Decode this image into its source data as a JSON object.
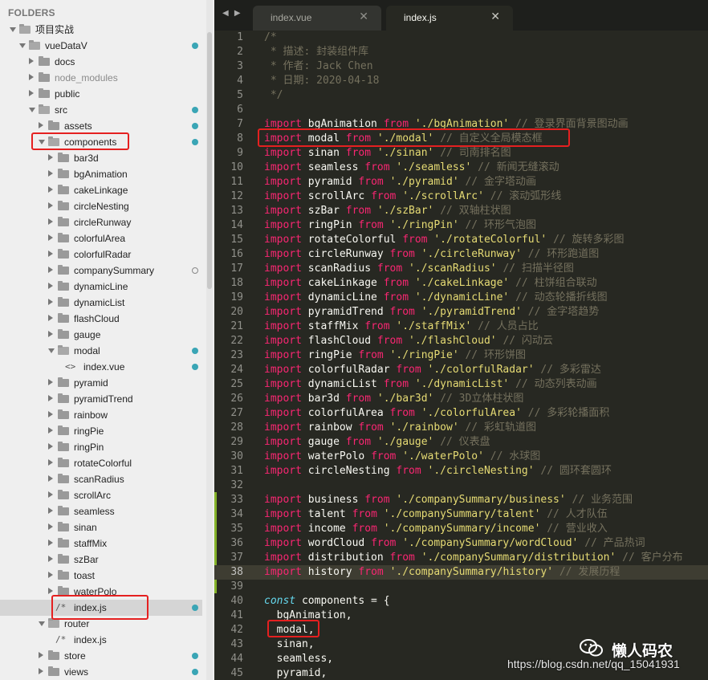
{
  "sidebar": {
    "header": "FOLDERS",
    "tree": [
      {
        "label": "项目实战",
        "depth": 0,
        "type": "folder",
        "expanded": true
      },
      {
        "label": "vueDataV",
        "depth": 1,
        "type": "folder",
        "expanded": true,
        "dot": "filled"
      },
      {
        "label": "docs",
        "depth": 2,
        "type": "folder",
        "expanded": false
      },
      {
        "label": "node_modules",
        "depth": 2,
        "type": "folder",
        "expanded": false,
        "muted": true
      },
      {
        "label": "public",
        "depth": 2,
        "type": "folder",
        "expanded": false
      },
      {
        "label": "src",
        "depth": 2,
        "type": "folder",
        "expanded": true,
        "dot": "filled"
      },
      {
        "label": "assets",
        "depth": 3,
        "type": "folder",
        "expanded": false,
        "dot": "filled"
      },
      {
        "label": "components",
        "depth": 3,
        "type": "folder",
        "expanded": true,
        "dot": "filled"
      },
      {
        "label": "bar3d",
        "depth": 4,
        "type": "folder",
        "expanded": false
      },
      {
        "label": "bgAnimation",
        "depth": 4,
        "type": "folder",
        "expanded": false
      },
      {
        "label": "cakeLinkage",
        "depth": 4,
        "type": "folder",
        "expanded": false
      },
      {
        "label": "circleNesting",
        "depth": 4,
        "type": "folder",
        "expanded": false
      },
      {
        "label": "circleRunway",
        "depth": 4,
        "type": "folder",
        "expanded": false
      },
      {
        "label": "colorfulArea",
        "depth": 4,
        "type": "folder",
        "expanded": false
      },
      {
        "label": "colorfulRadar",
        "depth": 4,
        "type": "folder",
        "expanded": false
      },
      {
        "label": "companySummary",
        "depth": 4,
        "type": "folder",
        "expanded": false,
        "dot": "hollow"
      },
      {
        "label": "dynamicLine",
        "depth": 4,
        "type": "folder",
        "expanded": false
      },
      {
        "label": "dynamicList",
        "depth": 4,
        "type": "folder",
        "expanded": false
      },
      {
        "label": "flashCloud",
        "depth": 4,
        "type": "folder",
        "expanded": false
      },
      {
        "label": "gauge",
        "depth": 4,
        "type": "folder",
        "expanded": false
      },
      {
        "label": "modal",
        "depth": 4,
        "type": "folder",
        "expanded": true,
        "dot": "filled"
      },
      {
        "label": "index.vue",
        "depth": 5,
        "type": "file",
        "icon": "<>",
        "dot": "filled"
      },
      {
        "label": "pyramid",
        "depth": 4,
        "type": "folder",
        "expanded": false
      },
      {
        "label": "pyramidTrend",
        "depth": 4,
        "type": "folder",
        "expanded": false
      },
      {
        "label": "rainbow",
        "depth": 4,
        "type": "folder",
        "expanded": false
      },
      {
        "label": "ringPie",
        "depth": 4,
        "type": "folder",
        "expanded": false
      },
      {
        "label": "ringPin",
        "depth": 4,
        "type": "folder",
        "expanded": false
      },
      {
        "label": "rotateColorful",
        "depth": 4,
        "type": "folder",
        "expanded": false
      },
      {
        "label": "scanRadius",
        "depth": 4,
        "type": "folder",
        "expanded": false
      },
      {
        "label": "scrollArc",
        "depth": 4,
        "type": "folder",
        "expanded": false
      },
      {
        "label": "seamless",
        "depth": 4,
        "type": "folder",
        "expanded": false
      },
      {
        "label": "sinan",
        "depth": 4,
        "type": "folder",
        "expanded": false
      },
      {
        "label": "staffMix",
        "depth": 4,
        "type": "folder",
        "expanded": false
      },
      {
        "label": "szBar",
        "depth": 4,
        "type": "folder",
        "expanded": false
      },
      {
        "label": "toast",
        "depth": 4,
        "type": "folder",
        "expanded": false
      },
      {
        "label": "waterPolo",
        "depth": 4,
        "type": "folder",
        "expanded": false
      },
      {
        "label": "index.js",
        "depth": 4,
        "type": "file",
        "icon": "/*",
        "dot": "filled",
        "selected": true
      },
      {
        "label": "router",
        "depth": 3,
        "type": "folder",
        "expanded": true
      },
      {
        "label": "index.js",
        "depth": 4,
        "type": "file",
        "icon": "/*"
      },
      {
        "label": "store",
        "depth": 3,
        "type": "folder",
        "expanded": false,
        "dot": "filled"
      },
      {
        "label": "views",
        "depth": 3,
        "type": "folder",
        "expanded": false,
        "dot": "filled"
      }
    ]
  },
  "tabs": {
    "nav": "◀ ▶",
    "items": [
      {
        "label": "index.vue",
        "close": "✕",
        "active": false
      },
      {
        "label": "index.js",
        "close": "✕",
        "active": true
      }
    ]
  },
  "editor": {
    "current_line": 38,
    "lines": [
      [
        [
          "c",
          "/*"
        ]
      ],
      [
        [
          "c",
          " * 描述: 封装组件库"
        ]
      ],
      [
        [
          "c",
          " * 作者: Jack Chen"
        ]
      ],
      [
        [
          "c",
          " * 日期: 2020-04-18"
        ]
      ],
      [
        [
          "c",
          " */"
        ]
      ],
      [],
      [
        [
          "k",
          "import"
        ],
        [
          "pl",
          " bgAnimation "
        ],
        [
          "k",
          "from"
        ],
        [
          "pl",
          " "
        ],
        [
          "s",
          "'./bgAnimation'"
        ],
        [
          "pl",
          " "
        ],
        [
          "c",
          "// 登录界面背景图动画"
        ]
      ],
      [
        [
          "k",
          "import"
        ],
        [
          "pl",
          " modal "
        ],
        [
          "k",
          "from"
        ],
        [
          "pl",
          " "
        ],
        [
          "s",
          "'./modal'"
        ],
        [
          "pl",
          " "
        ],
        [
          "c",
          "// 自定义全局模态框"
        ]
      ],
      [
        [
          "k",
          "import"
        ],
        [
          "pl",
          " sinan "
        ],
        [
          "k",
          "from"
        ],
        [
          "pl",
          " "
        ],
        [
          "s",
          "'./sinan'"
        ],
        [
          "pl",
          " "
        ],
        [
          "c",
          "// 司南排名图"
        ]
      ],
      [
        [
          "k",
          "import"
        ],
        [
          "pl",
          " seamless "
        ],
        [
          "k",
          "from"
        ],
        [
          "pl",
          " "
        ],
        [
          "s",
          "'./seamless'"
        ],
        [
          "pl",
          " "
        ],
        [
          "c",
          "// 新闻无缝滚动"
        ]
      ],
      [
        [
          "k",
          "import"
        ],
        [
          "pl",
          " pyramid "
        ],
        [
          "k",
          "from"
        ],
        [
          "pl",
          " "
        ],
        [
          "s",
          "'./pyramid'"
        ],
        [
          "pl",
          " "
        ],
        [
          "c",
          "// 金字塔动画"
        ]
      ],
      [
        [
          "k",
          "import"
        ],
        [
          "pl",
          " scrollArc "
        ],
        [
          "k",
          "from"
        ],
        [
          "pl",
          " "
        ],
        [
          "s",
          "'./scrollArc'"
        ],
        [
          "pl",
          " "
        ],
        [
          "c",
          "// 滚动弧形线"
        ]
      ],
      [
        [
          "k",
          "import"
        ],
        [
          "pl",
          " szBar "
        ],
        [
          "k",
          "from"
        ],
        [
          "pl",
          " "
        ],
        [
          "s",
          "'./szBar'"
        ],
        [
          "pl",
          " "
        ],
        [
          "c",
          "// 双轴柱状图"
        ]
      ],
      [
        [
          "k",
          "import"
        ],
        [
          "pl",
          " ringPin "
        ],
        [
          "k",
          "from"
        ],
        [
          "pl",
          " "
        ],
        [
          "s",
          "'./ringPin'"
        ],
        [
          "pl",
          " "
        ],
        [
          "c",
          "// 环形气泡图"
        ]
      ],
      [
        [
          "k",
          "import"
        ],
        [
          "pl",
          " rotateColorful "
        ],
        [
          "k",
          "from"
        ],
        [
          "pl",
          " "
        ],
        [
          "s",
          "'./rotateColorful'"
        ],
        [
          "pl",
          " "
        ],
        [
          "c",
          "// 旋转多彩图"
        ]
      ],
      [
        [
          "k",
          "import"
        ],
        [
          "pl",
          " circleRunway "
        ],
        [
          "k",
          "from"
        ],
        [
          "pl",
          " "
        ],
        [
          "s",
          "'./circleRunway'"
        ],
        [
          "pl",
          " "
        ],
        [
          "c",
          "// 环形跑道图"
        ]
      ],
      [
        [
          "k",
          "import"
        ],
        [
          "pl",
          " scanRadius "
        ],
        [
          "k",
          "from"
        ],
        [
          "pl",
          " "
        ],
        [
          "s",
          "'./scanRadius'"
        ],
        [
          "pl",
          " "
        ],
        [
          "c",
          "// 扫描半径图"
        ]
      ],
      [
        [
          "k",
          "import"
        ],
        [
          "pl",
          " cakeLinkage "
        ],
        [
          "k",
          "from"
        ],
        [
          "pl",
          " "
        ],
        [
          "s",
          "'./cakeLinkage'"
        ],
        [
          "pl",
          " "
        ],
        [
          "c",
          "// 柱饼组合联动"
        ]
      ],
      [
        [
          "k",
          "import"
        ],
        [
          "pl",
          " dynamicLine "
        ],
        [
          "k",
          "from"
        ],
        [
          "pl",
          " "
        ],
        [
          "s",
          "'./dynamicLine'"
        ],
        [
          "pl",
          " "
        ],
        [
          "c",
          "// 动态轮播折线图"
        ]
      ],
      [
        [
          "k",
          "import"
        ],
        [
          "pl",
          " pyramidTrend "
        ],
        [
          "k",
          "from"
        ],
        [
          "pl",
          " "
        ],
        [
          "s",
          "'./pyramidTrend'"
        ],
        [
          "pl",
          " "
        ],
        [
          "c",
          "// 金字塔趋势"
        ]
      ],
      [
        [
          "k",
          "import"
        ],
        [
          "pl",
          " staffMix "
        ],
        [
          "k",
          "from"
        ],
        [
          "pl",
          " "
        ],
        [
          "s",
          "'./staffMix'"
        ],
        [
          "pl",
          " "
        ],
        [
          "c",
          "// 人员占比"
        ]
      ],
      [
        [
          "k",
          "import"
        ],
        [
          "pl",
          " flashCloud "
        ],
        [
          "k",
          "from"
        ],
        [
          "pl",
          " "
        ],
        [
          "s",
          "'./flashCloud'"
        ],
        [
          "pl",
          " "
        ],
        [
          "c",
          "// 闪动云"
        ]
      ],
      [
        [
          "k",
          "import"
        ],
        [
          "pl",
          " ringPie "
        ],
        [
          "k",
          "from"
        ],
        [
          "pl",
          " "
        ],
        [
          "s",
          "'./ringPie'"
        ],
        [
          "pl",
          " "
        ],
        [
          "c",
          "// 环形饼图"
        ]
      ],
      [
        [
          "k",
          "import"
        ],
        [
          "pl",
          " colorfulRadar "
        ],
        [
          "k",
          "from"
        ],
        [
          "pl",
          " "
        ],
        [
          "s",
          "'./colorfulRadar'"
        ],
        [
          "pl",
          " "
        ],
        [
          "c",
          "// 多彩雷达"
        ]
      ],
      [
        [
          "k",
          "import"
        ],
        [
          "pl",
          " dynamicList "
        ],
        [
          "k",
          "from"
        ],
        [
          "pl",
          " "
        ],
        [
          "s",
          "'./dynamicList'"
        ],
        [
          "pl",
          " "
        ],
        [
          "c",
          "// 动态列表动画"
        ]
      ],
      [
        [
          "k",
          "import"
        ],
        [
          "pl",
          " bar3d "
        ],
        [
          "k",
          "from"
        ],
        [
          "pl",
          " "
        ],
        [
          "s",
          "'./bar3d'"
        ],
        [
          "pl",
          " "
        ],
        [
          "c",
          "// 3D立体柱状图"
        ]
      ],
      [
        [
          "k",
          "import"
        ],
        [
          "pl",
          " colorfulArea "
        ],
        [
          "k",
          "from"
        ],
        [
          "pl",
          " "
        ],
        [
          "s",
          "'./colorfulArea'"
        ],
        [
          "pl",
          " "
        ],
        [
          "c",
          "// 多彩轮播面积"
        ]
      ],
      [
        [
          "k",
          "import"
        ],
        [
          "pl",
          " rainbow "
        ],
        [
          "k",
          "from"
        ],
        [
          "pl",
          " "
        ],
        [
          "s",
          "'./rainbow'"
        ],
        [
          "pl",
          " "
        ],
        [
          "c",
          "// 彩虹轨道图"
        ]
      ],
      [
        [
          "k",
          "import"
        ],
        [
          "pl",
          " gauge "
        ],
        [
          "k",
          "from"
        ],
        [
          "pl",
          " "
        ],
        [
          "s",
          "'./gauge'"
        ],
        [
          "pl",
          " "
        ],
        [
          "c",
          "// 仪表盘"
        ]
      ],
      [
        [
          "k",
          "import"
        ],
        [
          "pl",
          " waterPolo "
        ],
        [
          "k",
          "from"
        ],
        [
          "pl",
          " "
        ],
        [
          "s",
          "'./waterPolo'"
        ],
        [
          "pl",
          " "
        ],
        [
          "c",
          "// 水球图"
        ]
      ],
      [
        [
          "k",
          "import"
        ],
        [
          "pl",
          " circleNesting "
        ],
        [
          "k",
          "from"
        ],
        [
          "pl",
          " "
        ],
        [
          "s",
          "'./circleNesting'"
        ],
        [
          "pl",
          " "
        ],
        [
          "c",
          "// 圆环套圆环"
        ]
      ],
      [],
      [
        [
          "k",
          "import"
        ],
        [
          "pl",
          " business "
        ],
        [
          "k",
          "from"
        ],
        [
          "pl",
          " "
        ],
        [
          "s",
          "'./companySummary/business'"
        ],
        [
          "pl",
          " "
        ],
        [
          "c",
          "// 业务范围"
        ]
      ],
      [
        [
          "k",
          "import"
        ],
        [
          "pl",
          " talent "
        ],
        [
          "k",
          "from"
        ],
        [
          "pl",
          " "
        ],
        [
          "s",
          "'./companySummary/talent'"
        ],
        [
          "pl",
          " "
        ],
        [
          "c",
          "// 人才队伍"
        ]
      ],
      [
        [
          "k",
          "import"
        ],
        [
          "pl",
          " income "
        ],
        [
          "k",
          "from"
        ],
        [
          "pl",
          " "
        ],
        [
          "s",
          "'./companySummary/income'"
        ],
        [
          "pl",
          " "
        ],
        [
          "c",
          "// 营业收入"
        ]
      ],
      [
        [
          "k",
          "import"
        ],
        [
          "pl",
          " wordCloud "
        ],
        [
          "k",
          "from"
        ],
        [
          "pl",
          " "
        ],
        [
          "s",
          "'./companySummary/wordCloud'"
        ],
        [
          "pl",
          " "
        ],
        [
          "c",
          "// 产品热词"
        ]
      ],
      [
        [
          "k",
          "import"
        ],
        [
          "pl",
          " distribution "
        ],
        [
          "k",
          "from"
        ],
        [
          "pl",
          " "
        ],
        [
          "s",
          "'./companySummary/distribution'"
        ],
        [
          "pl",
          " "
        ],
        [
          "c",
          "// 客户分布"
        ]
      ],
      [
        [
          "k",
          "import"
        ],
        [
          "pl",
          " history "
        ],
        [
          "k",
          "from"
        ],
        [
          "pl",
          " "
        ],
        [
          "s",
          "'./companySummary/history'"
        ],
        [
          "pl",
          " "
        ],
        [
          "c",
          "// 发展历程"
        ]
      ],
      [],
      [
        [
          "kw-const",
          "const"
        ],
        [
          "pl",
          " components = {"
        ]
      ],
      [
        [
          "pl",
          "  bgAnimation,"
        ]
      ],
      [
        [
          "pl",
          "  modal,"
        ]
      ],
      [
        [
          "pl",
          "  sinan,"
        ]
      ],
      [
        [
          "pl",
          "  seamless,"
        ]
      ],
      [
        [
          "pl",
          "  pyramid,"
        ]
      ]
    ]
  },
  "watermark": {
    "name": "懒人码农",
    "url": "https://blog.csdn.net/qq_15041931"
  },
  "colors": {
    "accent_dot": "#3aa5b5",
    "highlight_red": "#e52020",
    "keyword": "#f92672",
    "string": "#e6db74",
    "comment": "#75715e"
  }
}
